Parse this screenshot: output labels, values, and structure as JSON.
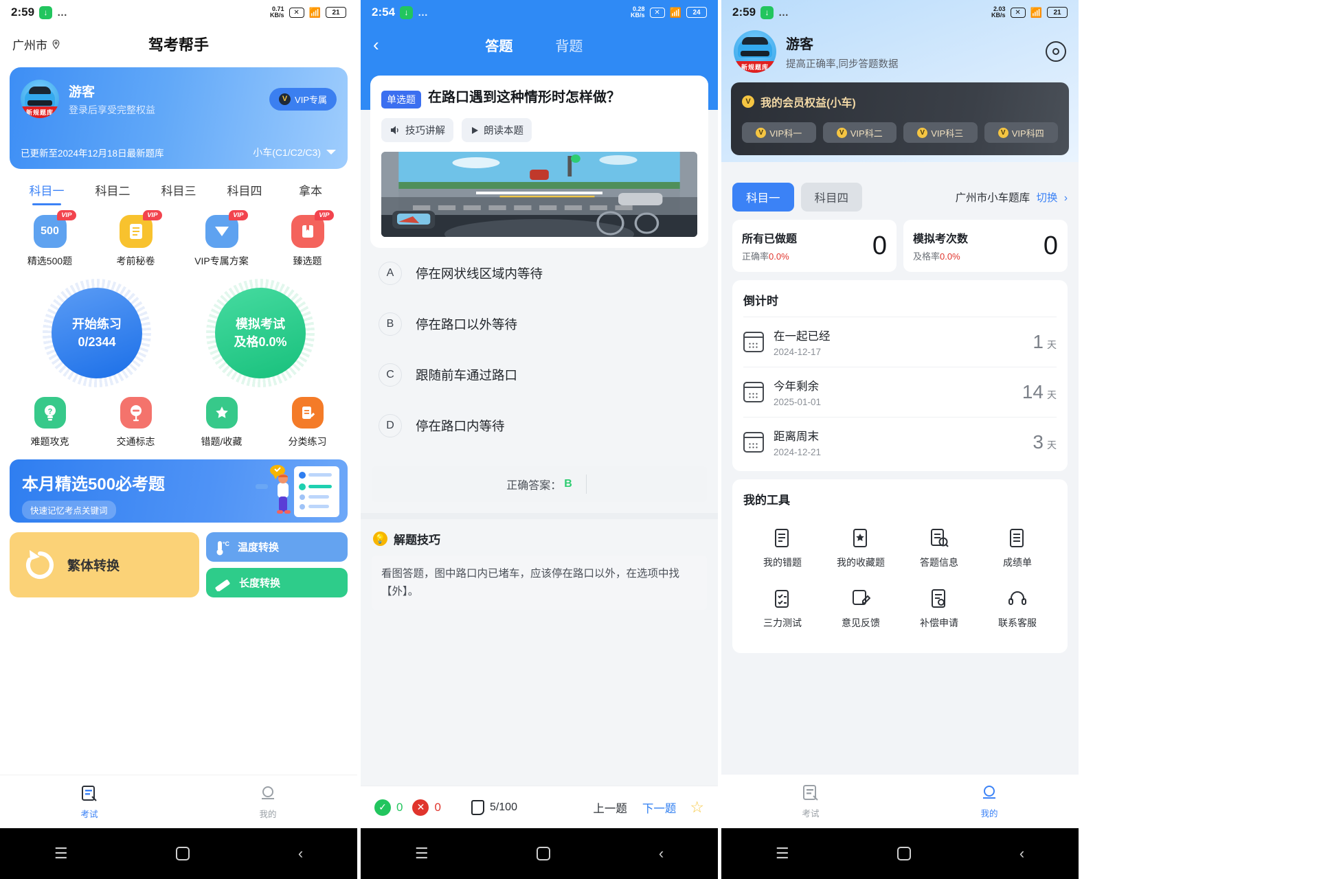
{
  "screen1": {
    "status": {
      "time": "2:59",
      "download_icon": "download-icon",
      "dots": "…",
      "speed": "0.71",
      "speed_unit": "KB/s",
      "mute_icon": "mute-icon",
      "wifi_icon": "wifi-icon",
      "battery": "21"
    },
    "header": {
      "city": "广州市",
      "location_icon": "location-pin-icon",
      "title": "驾考帮手"
    },
    "user_card": {
      "name": "游客",
      "subtitle": "登录后享受完整权益",
      "vip_button": "VIP专属",
      "update_text": "已更新至2024年12月18日最新题库",
      "car_type": "小车(C1/C2/C3)",
      "avatar_badge": "新规题库"
    },
    "tabs": [
      {
        "label": "科目一",
        "active": true
      },
      {
        "label": "科目二",
        "active": false
      },
      {
        "label": "科目三",
        "active": false
      },
      {
        "label": "科目四",
        "active": false
      },
      {
        "label": "拿本",
        "active": false
      }
    ],
    "quick_top": [
      {
        "label": "精选500题",
        "badge": "VIP",
        "icon": "500-icon",
        "color": "#5ea2f0"
      },
      {
        "label": "考前秘卷",
        "badge": "VIP",
        "icon": "document-icon",
        "color": "#f8c22e"
      },
      {
        "label": "VIP专属方案",
        "badge": "VIP",
        "icon": "diamond-icon",
        "color": "#5ea2f0"
      },
      {
        "label": "臻选题",
        "badge": "VIP",
        "icon": "book-icon",
        "color": "#f4635c"
      }
    ],
    "circles": [
      {
        "title": "开始练习",
        "value": "0/2344",
        "color": "#2f7ef0"
      },
      {
        "title": "模拟考试",
        "value": "及格0.0%",
        "color": "#2ecc8a"
      }
    ],
    "quick_bottom": [
      {
        "label": "难题攻克",
        "icon": "lightbulb-question-icon",
        "color": "#37c98a",
        "glyph": "?"
      },
      {
        "label": "交通标志",
        "icon": "traffic-sign-icon",
        "color": "#f4736c",
        "glyph": "−"
      },
      {
        "label": "错题/收藏",
        "icon": "star-icon",
        "color": "#37c98a",
        "glyph": "★"
      },
      {
        "label": "分类练习",
        "icon": "edit-doc-icon",
        "color": "#f47b28",
        "glyph": "✎"
      }
    ],
    "banner": {
      "title": "本月精选500必考题",
      "chip": "快速记忆考点关键词"
    },
    "tools": {
      "big": {
        "label": "繁体转换",
        "icon": "refresh-icon"
      },
      "small": [
        {
          "label": "温度转换",
          "icon": "thermometer-icon"
        },
        {
          "label": "长度转换",
          "icon": "ruler-icon"
        }
      ]
    },
    "tabbar": [
      {
        "label": "考试",
        "icon": "exam-icon",
        "active": true
      },
      {
        "label": "我的",
        "icon": "person-icon",
        "active": false
      }
    ]
  },
  "screen2": {
    "status": {
      "time": "2:54",
      "download_icon": "download-icon",
      "dots": "…",
      "speed": "0.28",
      "speed_unit": "KB/s",
      "mute_icon": "mute-icon",
      "wifi_icon": "wifi-icon",
      "battery": "24"
    },
    "header": {
      "back_icon": "back-chevron-icon",
      "tabs": [
        {
          "label": "答题",
          "active": true
        },
        {
          "label": "背题",
          "active": false
        }
      ]
    },
    "question": {
      "type_badge": "单选题",
      "text": "在路口遇到这种情形时怎样做？",
      "actions": [
        {
          "label": "技巧讲解",
          "icon": "speaker-icon"
        },
        {
          "label": "朗读本题",
          "icon": "play-icon"
        }
      ],
      "image_alt": "路口行车情景图"
    },
    "options": [
      {
        "key": "A",
        "text": "停在网状线区域内等待"
      },
      {
        "key": "B",
        "text": "停在路口以外等待"
      },
      {
        "key": "C",
        "text": "跟随前车通过路口"
      },
      {
        "key": "D",
        "text": "停在路口内等待"
      }
    ],
    "answer": {
      "label": "正确答案：",
      "value": "B"
    },
    "tip": {
      "title": "解题技巧",
      "icon": "lightbulb-icon",
      "body": "看图答题，图中路口内已堵车，应该停在路口以外，在选项中找【外】。"
    },
    "bottom": {
      "correct_count": "0",
      "wrong_count": "0",
      "progress": "5/100",
      "prev": "上一题",
      "next": "下一题",
      "star_icon": "star-outline-icon"
    }
  },
  "screen3": {
    "status": {
      "time": "2:59",
      "download_icon": "download-icon",
      "dots": "…",
      "speed": "2.03",
      "speed_unit": "KB/s",
      "mute_icon": "mute-icon",
      "wifi_icon": "wifi-icon",
      "battery": "21"
    },
    "user": {
      "name": "游客",
      "subtitle": "提高正确率,同步答题数据",
      "settings_icon": "settings-gear-icon",
      "avatar_badge": "新规题库"
    },
    "vip_card": {
      "title": "我的会员权益(小车)",
      "chips": [
        "VIP科一",
        "VIP科二",
        "VIP科三",
        "VIP科四"
      ]
    },
    "subject_row": {
      "subjects": [
        {
          "label": "科目一",
          "active": true
        },
        {
          "label": "科目四",
          "active": false
        }
      ],
      "bank": "广州市小车题库",
      "switch": "切换",
      "switch_icon": "chevron-right-icon"
    },
    "stats": [
      {
        "title": "所有已做题",
        "sub_prefix": "正确率",
        "sub_value": "0.0%",
        "value": "0"
      },
      {
        "title": "模拟考次数",
        "sub_prefix": "及格率",
        "sub_value": "0.0%",
        "value": "0"
      }
    ],
    "countdown": {
      "title": "倒计时",
      "rows": [
        {
          "label": "在一起已经",
          "date": "2024-12-17",
          "value": "1",
          "unit": "天",
          "icon": "calendar-icon"
        },
        {
          "label": "今年剩余",
          "date": "2025-01-01",
          "value": "14",
          "unit": "天",
          "icon": "calendar-icon"
        },
        {
          "label": "距离周末",
          "date": "2024-12-21",
          "value": "3",
          "unit": "天",
          "icon": "calendar-icon"
        }
      ]
    },
    "tools": {
      "title": "我的工具",
      "items": [
        {
          "label": "我的错题",
          "icon": "wrong-questions-icon"
        },
        {
          "label": "我的收藏题",
          "icon": "favorites-icon"
        },
        {
          "label": "答题信息",
          "icon": "answer-info-icon"
        },
        {
          "label": "成绩单",
          "icon": "score-sheet-icon"
        },
        {
          "label": "三力测试",
          "icon": "three-ability-test-icon"
        },
        {
          "label": "意见反馈",
          "icon": "feedback-icon"
        },
        {
          "label": "补偿申请",
          "icon": "compensation-icon"
        },
        {
          "label": "联系客服",
          "icon": "customer-service-icon"
        }
      ]
    },
    "tabbar": [
      {
        "label": "考试",
        "icon": "exam-icon",
        "active": false
      },
      {
        "label": "我的",
        "icon": "person-icon",
        "active": true
      }
    ]
  },
  "navbar": {
    "menu_icon": "menu-icon",
    "home_icon": "home-icon",
    "back_icon": "back-icon"
  }
}
